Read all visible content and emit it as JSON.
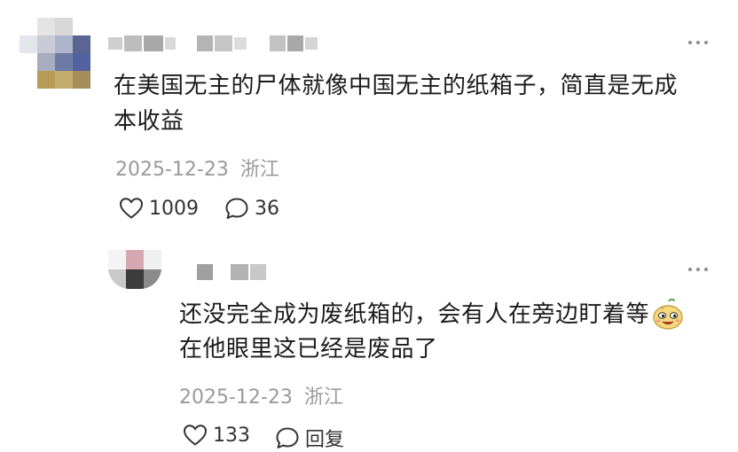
{
  "comment": {
    "text_line1": "在美国无主的尸体就像中国无主的纸箱子，简直是无成",
    "text_line2": "本收益",
    "date": "2025-12-23",
    "location": "浙江",
    "like_count": "1009",
    "reply_count": "36",
    "like_icon": "heart-outline-icon",
    "reply_icon": "speech-bubble-icon"
  },
  "reply": {
    "text_line1": "还没完全成为废纸箱的，会有人在旁边盯着等",
    "text_line2": "在他眼里这已经是废品了",
    "emoji": "sly-face-emoji",
    "date": "2025-12-23",
    "location": "浙江",
    "like_count": "133",
    "reply_label": "回复"
  },
  "colors": {
    "text": "#1b1b1b",
    "meta": "#9a9a9a",
    "icon": "#333333"
  }
}
